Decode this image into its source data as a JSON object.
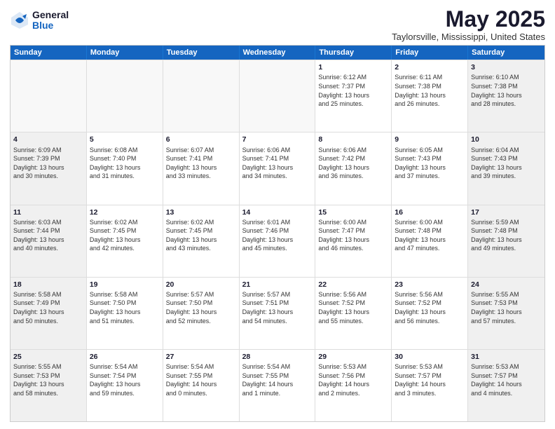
{
  "header": {
    "logo_general": "General",
    "logo_blue": "Blue",
    "month_title": "May 2025",
    "location": "Taylorsville, Mississippi, United States"
  },
  "calendar": {
    "days_of_week": [
      "Sunday",
      "Monday",
      "Tuesday",
      "Wednesday",
      "Thursday",
      "Friday",
      "Saturday"
    ],
    "rows": [
      [
        {
          "day": "",
          "info": "",
          "empty": true
        },
        {
          "day": "",
          "info": "",
          "empty": true
        },
        {
          "day": "",
          "info": "",
          "empty": true
        },
        {
          "day": "",
          "info": "",
          "empty": true
        },
        {
          "day": "1",
          "info": "Sunrise: 6:12 AM\nSunset: 7:37 PM\nDaylight: 13 hours\nand 25 minutes."
        },
        {
          "day": "2",
          "info": "Sunrise: 6:11 AM\nSunset: 7:38 PM\nDaylight: 13 hours\nand 26 minutes."
        },
        {
          "day": "3",
          "info": "Sunrise: 6:10 AM\nSunset: 7:38 PM\nDaylight: 13 hours\nand 28 minutes."
        }
      ],
      [
        {
          "day": "4",
          "info": "Sunrise: 6:09 AM\nSunset: 7:39 PM\nDaylight: 13 hours\nand 30 minutes."
        },
        {
          "day": "5",
          "info": "Sunrise: 6:08 AM\nSunset: 7:40 PM\nDaylight: 13 hours\nand 31 minutes."
        },
        {
          "day": "6",
          "info": "Sunrise: 6:07 AM\nSunset: 7:41 PM\nDaylight: 13 hours\nand 33 minutes."
        },
        {
          "day": "7",
          "info": "Sunrise: 6:06 AM\nSunset: 7:41 PM\nDaylight: 13 hours\nand 34 minutes."
        },
        {
          "day": "8",
          "info": "Sunrise: 6:06 AM\nSunset: 7:42 PM\nDaylight: 13 hours\nand 36 minutes."
        },
        {
          "day": "9",
          "info": "Sunrise: 6:05 AM\nSunset: 7:43 PM\nDaylight: 13 hours\nand 37 minutes."
        },
        {
          "day": "10",
          "info": "Sunrise: 6:04 AM\nSunset: 7:43 PM\nDaylight: 13 hours\nand 39 minutes."
        }
      ],
      [
        {
          "day": "11",
          "info": "Sunrise: 6:03 AM\nSunset: 7:44 PM\nDaylight: 13 hours\nand 40 minutes."
        },
        {
          "day": "12",
          "info": "Sunrise: 6:02 AM\nSunset: 7:45 PM\nDaylight: 13 hours\nand 42 minutes."
        },
        {
          "day": "13",
          "info": "Sunrise: 6:02 AM\nSunset: 7:45 PM\nDaylight: 13 hours\nand 43 minutes."
        },
        {
          "day": "14",
          "info": "Sunrise: 6:01 AM\nSunset: 7:46 PM\nDaylight: 13 hours\nand 45 minutes."
        },
        {
          "day": "15",
          "info": "Sunrise: 6:00 AM\nSunset: 7:47 PM\nDaylight: 13 hours\nand 46 minutes."
        },
        {
          "day": "16",
          "info": "Sunrise: 6:00 AM\nSunset: 7:48 PM\nDaylight: 13 hours\nand 47 minutes."
        },
        {
          "day": "17",
          "info": "Sunrise: 5:59 AM\nSunset: 7:48 PM\nDaylight: 13 hours\nand 49 minutes."
        }
      ],
      [
        {
          "day": "18",
          "info": "Sunrise: 5:58 AM\nSunset: 7:49 PM\nDaylight: 13 hours\nand 50 minutes."
        },
        {
          "day": "19",
          "info": "Sunrise: 5:58 AM\nSunset: 7:50 PM\nDaylight: 13 hours\nand 51 minutes."
        },
        {
          "day": "20",
          "info": "Sunrise: 5:57 AM\nSunset: 7:50 PM\nDaylight: 13 hours\nand 52 minutes."
        },
        {
          "day": "21",
          "info": "Sunrise: 5:57 AM\nSunset: 7:51 PM\nDaylight: 13 hours\nand 54 minutes."
        },
        {
          "day": "22",
          "info": "Sunrise: 5:56 AM\nSunset: 7:52 PM\nDaylight: 13 hours\nand 55 minutes."
        },
        {
          "day": "23",
          "info": "Sunrise: 5:56 AM\nSunset: 7:52 PM\nDaylight: 13 hours\nand 56 minutes."
        },
        {
          "day": "24",
          "info": "Sunrise: 5:55 AM\nSunset: 7:53 PM\nDaylight: 13 hours\nand 57 minutes."
        }
      ],
      [
        {
          "day": "25",
          "info": "Sunrise: 5:55 AM\nSunset: 7:53 PM\nDaylight: 13 hours\nand 58 minutes."
        },
        {
          "day": "26",
          "info": "Sunrise: 5:54 AM\nSunset: 7:54 PM\nDaylight: 13 hours\nand 59 minutes."
        },
        {
          "day": "27",
          "info": "Sunrise: 5:54 AM\nSunset: 7:55 PM\nDaylight: 14 hours\nand 0 minutes."
        },
        {
          "day": "28",
          "info": "Sunrise: 5:54 AM\nSunset: 7:55 PM\nDaylight: 14 hours\nand 1 minute."
        },
        {
          "day": "29",
          "info": "Sunrise: 5:53 AM\nSunset: 7:56 PM\nDaylight: 14 hours\nand 2 minutes."
        },
        {
          "day": "30",
          "info": "Sunrise: 5:53 AM\nSunset: 7:57 PM\nDaylight: 14 hours\nand 3 minutes."
        },
        {
          "day": "31",
          "info": "Sunrise: 5:53 AM\nSunset: 7:57 PM\nDaylight: 14 hours\nand 4 minutes."
        }
      ]
    ]
  }
}
